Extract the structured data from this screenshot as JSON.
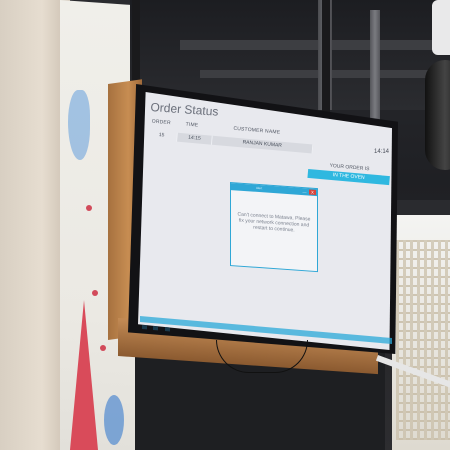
{
  "app": {
    "title": "Order Status",
    "time": "14:14"
  },
  "table": {
    "headers": [
      "ORDER",
      "TIME",
      "CUSTOMER NAME"
    ],
    "row": {
      "order": "15",
      "time": "14:15",
      "customer": "RANJAN KUMAR"
    }
  },
  "your_order": {
    "label": "YOUR ORDER IS",
    "status": "IN THE OVEN"
  },
  "dialog": {
    "title": "Alert",
    "minimize": "—",
    "close": "X",
    "message": "Can't connect to Matawa. Please fix your network connection and restart to continue."
  },
  "colors": {
    "accent": "#2fb8e0",
    "screen_bg": "#e8e9ee",
    "close_button": "#d8453c"
  }
}
